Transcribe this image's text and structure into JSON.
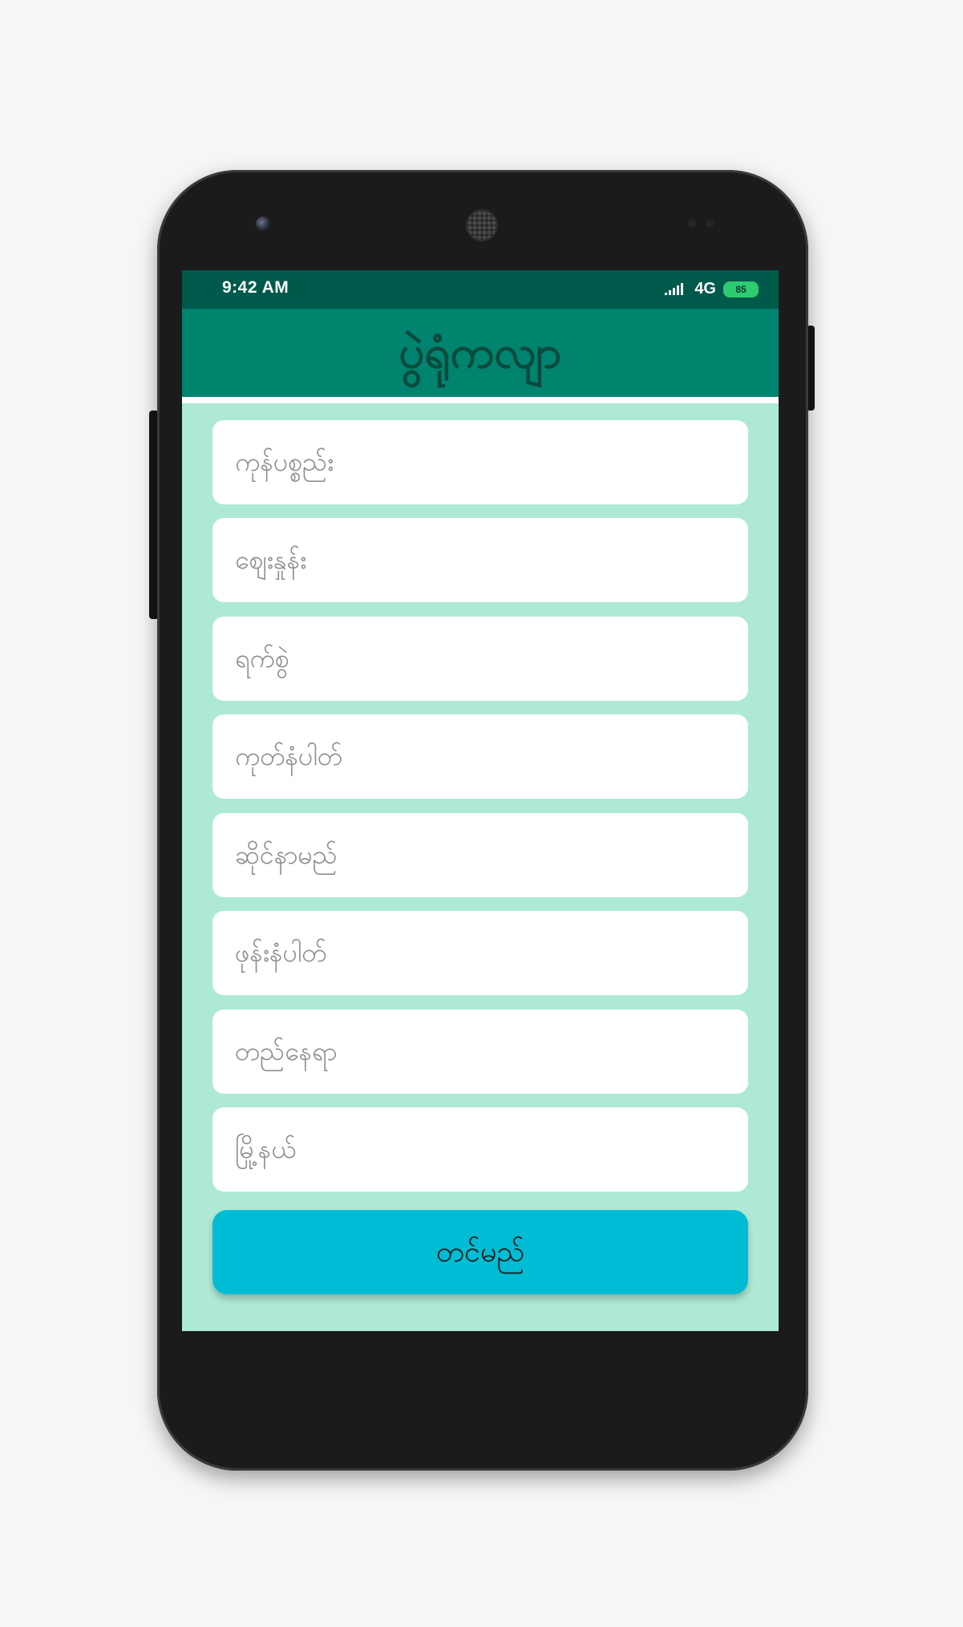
{
  "status_bar": {
    "time": "9:42 AM",
    "network": "4G",
    "battery": "85",
    "icons": [
      "signal-icon",
      "battery-icon"
    ]
  },
  "app_bar": {
    "title": "ပွဲရုံကလျာ"
  },
  "form": {
    "fields": [
      {
        "placeholder": "ကုန်ပစ္စည်း"
      },
      {
        "placeholder": "ဈေးနှုန်း"
      },
      {
        "placeholder": "ရက်စွဲ"
      },
      {
        "placeholder": "ကုတ်နံပါတ်"
      },
      {
        "placeholder": "ဆိုင်နာမည်"
      },
      {
        "placeholder": "ဖုန်းနံပါတ်"
      },
      {
        "placeholder": "တည်နေရာ"
      },
      {
        "placeholder": "မြို့နယ်"
      }
    ],
    "submit_label": "တင်မည်"
  },
  "colors": {
    "status_bar": "#005a4b",
    "app_bar": "#00836f",
    "title_text": "#0a4a3d",
    "form_background": "#aee9d6",
    "submit_button": "#00bcd4"
  }
}
